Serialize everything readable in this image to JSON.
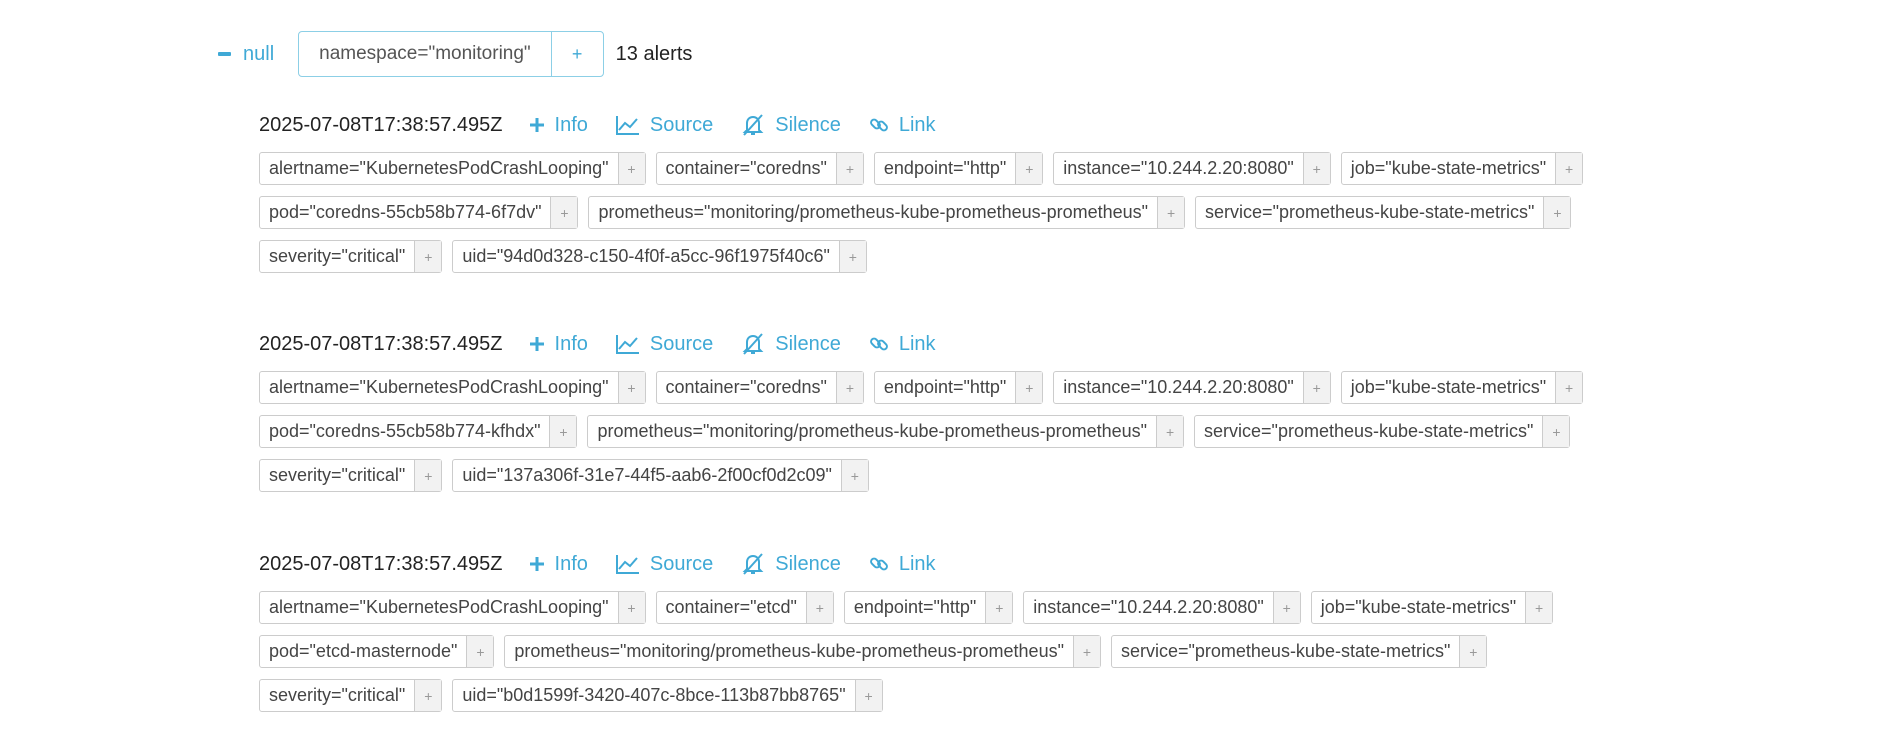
{
  "group": {
    "toggle_label": "null",
    "filter_label": "namespace=\"monitoring\"",
    "filter_add": "+",
    "count_text": "13 alerts"
  },
  "colors": {
    "accent": "#3fa9d6",
    "chip_border": "#cccccc",
    "chip_add_bg": "#f2f2f2"
  },
  "alerts": [
    {
      "timestamp": "2025-07-08T17:38:57.495Z",
      "actions": {
        "info": "Info",
        "source": "Source",
        "silence": "Silence",
        "link": "Link"
      },
      "rows": [
        [
          "alertname=\"KubernetesPodCrashLooping\"",
          "container=\"coredns\"",
          "endpoint=\"http\"",
          "instance=\"10.244.2.20:8080\"",
          "job=\"kube-state-metrics\""
        ],
        [
          "pod=\"coredns-55cb58b774-6f7dv\"",
          "prometheus=\"monitoring/prometheus-kube-prometheus-prometheus\"",
          "service=\"prometheus-kube-state-metrics\""
        ],
        [
          "severity=\"critical\"",
          "uid=\"94d0d328-c150-4f0f-a5cc-96f1975f40c6\""
        ]
      ]
    },
    {
      "timestamp": "2025-07-08T17:38:57.495Z",
      "actions": {
        "info": "Info",
        "source": "Source",
        "silence": "Silence",
        "link": "Link"
      },
      "rows": [
        [
          "alertname=\"KubernetesPodCrashLooping\"",
          "container=\"coredns\"",
          "endpoint=\"http\"",
          "instance=\"10.244.2.20:8080\"",
          "job=\"kube-state-metrics\""
        ],
        [
          "pod=\"coredns-55cb58b774-kfhdx\"",
          "prometheus=\"monitoring/prometheus-kube-prometheus-prometheus\"",
          "service=\"prometheus-kube-state-metrics\""
        ],
        [
          "severity=\"critical\"",
          "uid=\"137a306f-31e7-44f5-aab6-2f00cf0d2c09\""
        ]
      ]
    },
    {
      "timestamp": "2025-07-08T17:38:57.495Z",
      "actions": {
        "info": "Info",
        "source": "Source",
        "silence": "Silence",
        "link": "Link"
      },
      "rows": [
        [
          "alertname=\"KubernetesPodCrashLooping\"",
          "container=\"etcd\"",
          "endpoint=\"http\"",
          "instance=\"10.244.2.20:8080\"",
          "job=\"kube-state-metrics\""
        ],
        [
          "pod=\"etcd-masternode\"",
          "prometheus=\"monitoring/prometheus-kube-prometheus-prometheus\"",
          "service=\"prometheus-kube-state-metrics\""
        ],
        [
          "severity=\"critical\"",
          "uid=\"b0d1599f-3420-407c-8bce-113b87bb8765\""
        ]
      ]
    }
  ],
  "chip_add_symbol": "+"
}
